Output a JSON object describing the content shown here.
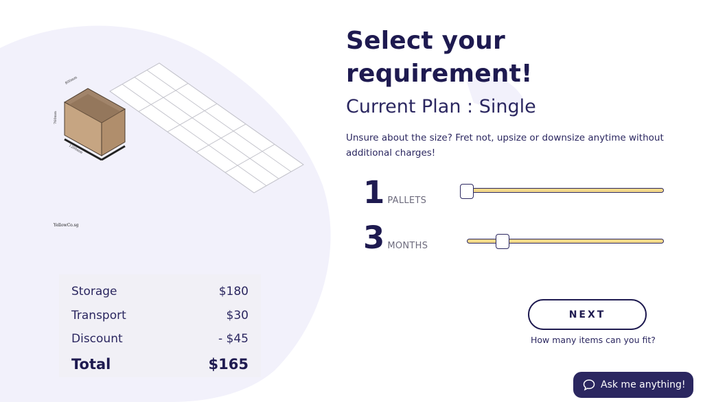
{
  "illustration": {
    "brand": "YellowCo.sg",
    "dim_top": "800mm",
    "dim_side": "760mm",
    "dim_bottom": "1200mm"
  },
  "headline": {
    "line1": "Select your",
    "line2": "requirement!"
  },
  "plan": "Current Plan : Single",
  "description": "Unsure about the size? Fret not, upsize or downsize anytime without additional charges!",
  "sliders": [
    {
      "value": "1",
      "unit": "PALLETS",
      "level": 0
    },
    {
      "value": "3",
      "unit": "MONTHS",
      "level": 0.2
    }
  ],
  "summary": {
    "rows": [
      {
        "label": "Storage",
        "amount": "$180"
      },
      {
        "label": "Transport",
        "amount": "$30"
      },
      {
        "label": "Discount",
        "amount": "- $45"
      }
    ],
    "total_label": "Total",
    "total_amount": "$165"
  },
  "next_button": "NEXT",
  "fit_link": "How many items can you fit?",
  "chat": {
    "label": "Ask me anything!",
    "icon": "chat-bubble-icon"
  },
  "colors": {
    "navy": "#1e1a50",
    "blob": "#f2f1fb",
    "slider_fill": "#f4d98a",
    "chat_bg": "#2b2760"
  }
}
